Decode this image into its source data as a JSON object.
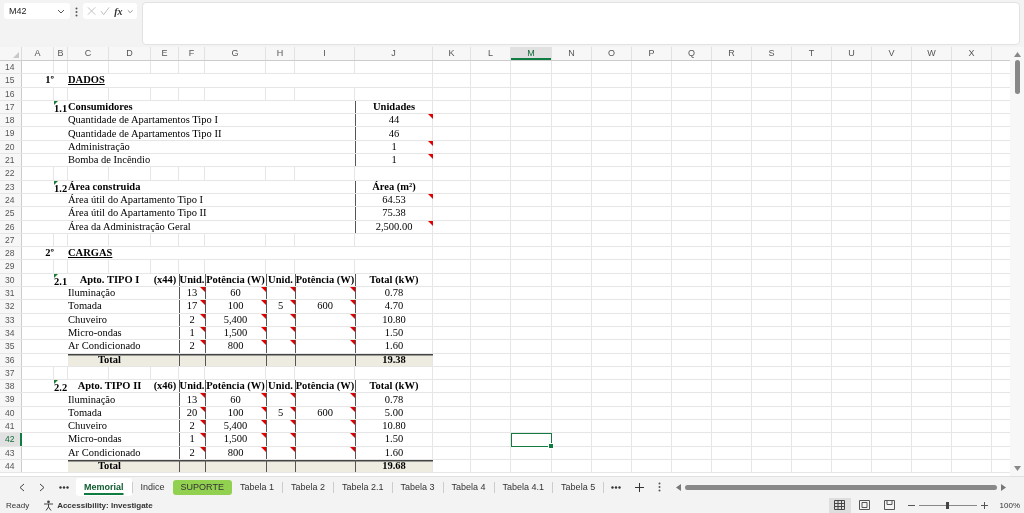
{
  "formula_bar": {
    "name_box": "M42",
    "function_label": "fx"
  },
  "columns": [
    {
      "label": "A",
      "selected": false
    },
    {
      "label": "B",
      "selected": false
    },
    {
      "label": "C",
      "selected": false
    },
    {
      "label": "D",
      "selected": false
    },
    {
      "label": "E",
      "selected": false
    },
    {
      "label": "F",
      "selected": false
    },
    {
      "label": "G",
      "selected": false
    },
    {
      "label": "H",
      "selected": false
    },
    {
      "label": "I",
      "selected": false
    },
    {
      "label": "J",
      "selected": false
    },
    {
      "label": "K",
      "selected": false
    },
    {
      "label": "L",
      "selected": false
    },
    {
      "label": "M",
      "selected": true
    },
    {
      "label": "N",
      "selected": false
    },
    {
      "label": "O",
      "selected": false
    },
    {
      "label": "P",
      "selected": false
    },
    {
      "label": "Q",
      "selected": false
    },
    {
      "label": "R",
      "selected": false
    },
    {
      "label": "S",
      "selected": false
    },
    {
      "label": "T",
      "selected": false
    },
    {
      "label": "U",
      "selected": false
    },
    {
      "label": "V",
      "selected": false
    },
    {
      "label": "W",
      "selected": false
    },
    {
      "label": "X",
      "selected": false
    }
  ],
  "rows": [
    {
      "number": "14",
      "selected": false,
      "kind": "blank"
    },
    {
      "number": "15",
      "selected": false,
      "kind": "section",
      "ordinal": "1º",
      "title": "DADOS"
    },
    {
      "number": "16",
      "selected": false,
      "kind": "blank"
    },
    {
      "number": "17",
      "selected": false,
      "kind": "group",
      "index": "1.1",
      "error_flag": true,
      "title": "Consumidores",
      "value_header": "Unidades"
    },
    {
      "number": "18",
      "selected": false,
      "kind": "item",
      "label": "Quantidade de Apartamentos Tipo I",
      "value": "44",
      "comment": true
    },
    {
      "number": "19",
      "selected": false,
      "kind": "item",
      "label": "Quantidade de Apartamentos Tipo II",
      "value": "46",
      "comment": false
    },
    {
      "number": "20",
      "selected": false,
      "kind": "item",
      "label": "Administração",
      "value": "1",
      "comment": true
    },
    {
      "number": "21",
      "selected": false,
      "kind": "item",
      "label": "Bomba de Incêndio",
      "value": "1",
      "comment": true
    },
    {
      "number": "22",
      "selected": false,
      "kind": "blank"
    },
    {
      "number": "23",
      "selected": false,
      "kind": "group",
      "index": "1.2",
      "error_flag": true,
      "title": "Área construida",
      "value_header": "Área (m²)"
    },
    {
      "number": "24",
      "selected": false,
      "kind": "item",
      "label": "Área útil do Apartamento Tipo I",
      "value": "64.53",
      "comment": true
    },
    {
      "number": "25",
      "selected": false,
      "kind": "item",
      "label": "Área útil do Apartamento Tipo II",
      "value": "75.38",
      "comment": false
    },
    {
      "number": "26",
      "selected": false,
      "kind": "item",
      "label": "Área da Administração Geral",
      "value": "2,500.00",
      "comment": true
    },
    {
      "number": "27",
      "selected": false,
      "kind": "blank"
    },
    {
      "number": "28",
      "selected": false,
      "kind": "section",
      "ordinal": "2º",
      "title": "CARGAS"
    },
    {
      "number": "29",
      "selected": false,
      "kind": "blank"
    },
    {
      "number": "30",
      "selected": false,
      "kind": "table_header",
      "index": "2.1",
      "error_flag": true,
      "title": "Apto. TIPO I",
      "multiplier": "(x44)",
      "headers": [
        "Unid.",
        "Potência (W)",
        "Unid.",
        "Potência (W)",
        "Total (kW)"
      ]
    },
    {
      "number": "31",
      "selected": false,
      "kind": "table_item",
      "label": "Iluminação",
      "cells": [
        {
          "text": "13",
          "comment": true
        },
        {
          "text": "60",
          "comment": true
        },
        {
          "comment": true
        },
        {
          "comment": true
        },
        {
          "text": "0.78",
          "comment": false
        }
      ]
    },
    {
      "number": "32",
      "selected": false,
      "kind": "table_item",
      "label": "Tomada",
      "cells": [
        {
          "text": "17",
          "comment": true
        },
        {
          "text": "100",
          "comment": true
        },
        {
          "text": "5",
          "comment": true
        },
        {
          "text": "600",
          "comment": true
        },
        {
          "text": "4.70",
          "comment": false
        }
      ]
    },
    {
      "number": "33",
      "selected": false,
      "kind": "table_item",
      "label": "Chuveiro",
      "cells": [
        {
          "text": "2",
          "comment": true
        },
        {
          "text": "5,400",
          "comment": true
        },
        {
          "comment": true
        },
        {
          "comment": true
        },
        {
          "text": "10.80",
          "comment": false
        }
      ]
    },
    {
      "number": "34",
      "selected": false,
      "kind": "table_item",
      "label": "Micro-ondas",
      "cells": [
        {
          "text": "1",
          "comment": true
        },
        {
          "text": "1,500",
          "comment": true
        },
        {
          "comment": true
        },
        {
          "comment": true
        },
        {
          "text": "1.50",
          "comment": false
        }
      ]
    },
    {
      "number": "35",
      "selected": false,
      "kind": "table_item",
      "label": "Ar Condicionado",
      "cells": [
        {
          "text": "2",
          "comment": true
        },
        {
          "text": "800",
          "comment": true
        },
        {
          "comment": true
        },
        {
          "comment": true
        },
        {
          "text": "1.60",
          "comment": false
        }
      ]
    },
    {
      "number": "36",
      "selected": false,
      "kind": "total",
      "label": "Total",
      "value": "19.38"
    },
    {
      "number": "37",
      "selected": false,
      "kind": "blank"
    },
    {
      "number": "38",
      "selected": false,
      "kind": "table_header",
      "index": "2.2",
      "error_flag": true,
      "title": "Apto. TIPO II",
      "multiplier": "(x46)",
      "headers": [
        "Unid.",
        "Potência (W)",
        "Unid.",
        "Potência (W)",
        "Total (kW)"
      ]
    },
    {
      "number": "39",
      "selected": false,
      "kind": "table_item",
      "label": "Iluminação",
      "cells": [
        {
          "text": "13",
          "comment": true
        },
        {
          "text": "60",
          "comment": true
        },
        {
          "comment": true
        },
        {
          "comment": true
        },
        {
          "text": "0.78",
          "comment": false
        }
      ]
    },
    {
      "number": "40",
      "selected": false,
      "kind": "table_item",
      "label": "Tomada",
      "cells": [
        {
          "text": "20",
          "comment": true
        },
        {
          "text": "100",
          "comment": true
        },
        {
          "text": "5",
          "comment": true
        },
        {
          "text": "600",
          "comment": true
        },
        {
          "text": "5.00",
          "comment": false
        }
      ]
    },
    {
      "number": "41",
      "selected": false,
      "kind": "table_item",
      "label": "Chuveiro",
      "cells": [
        {
          "text": "2",
          "comment": true
        },
        {
          "text": "5,400",
          "comment": true
        },
        {
          "comment": true
        },
        {
          "comment": true
        },
        {
          "text": "10.80",
          "comment": false
        }
      ]
    },
    {
      "number": "42",
      "selected": true,
      "kind": "table_item",
      "label": "Micro-ondas",
      "cells": [
        {
          "text": "1",
          "comment": true
        },
        {
          "text": "1,500",
          "comment": true
        },
        {
          "comment": true
        },
        {
          "comment": true
        },
        {
          "text": "1.50",
          "comment": false
        }
      ]
    },
    {
      "number": "43",
      "selected": false,
      "kind": "table_item",
      "label": "Ar Condicionado",
      "cells": [
        {
          "text": "2",
          "comment": true
        },
        {
          "text": "800",
          "comment": true
        },
        {
          "comment": true
        },
        {
          "comment": true
        },
        {
          "text": "1.60",
          "comment": false
        }
      ]
    },
    {
      "number": "44",
      "selected": false,
      "kind": "total",
      "label": "Total",
      "value": "19.68"
    }
  ],
  "sheet_tabs": [
    {
      "label": "Memorial",
      "selected": true
    },
    {
      "label": "Indice",
      "selected": false
    },
    {
      "label": "SUPORTE",
      "selected": false,
      "color": "#92d050"
    },
    {
      "label": "Tabela 1",
      "selected": false
    },
    {
      "label": "Tabela 2",
      "selected": false
    },
    {
      "label": "Tabela 2.1",
      "selected": false
    },
    {
      "label": "Tabela 3",
      "selected": false
    },
    {
      "label": "Tabela 4",
      "selected": false
    },
    {
      "label": "Tabela 4.1",
      "selected": false
    },
    {
      "label": "Tabela 5",
      "selected": false
    }
  ],
  "status_bar": {
    "status": "Ready",
    "accessibility": "Accessibility: Investigate",
    "views": [
      {
        "kind": "normal",
        "selected": true
      },
      {
        "kind": "page_layout",
        "selected": false
      },
      {
        "kind": "page_break",
        "selected": false
      }
    ],
    "zoom": {
      "level": 0.5,
      "reading": "100%"
    }
  }
}
